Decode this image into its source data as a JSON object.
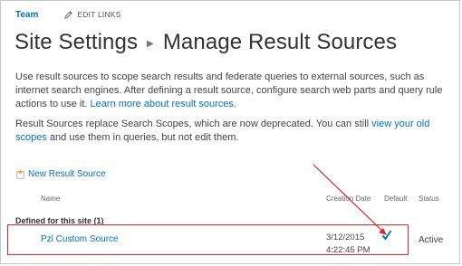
{
  "nav": {
    "site": "Team",
    "edit_links": "EDIT LINKS"
  },
  "page": {
    "breadcrumb_parent": "Site Settings",
    "title": "Manage Result Sources"
  },
  "intro": {
    "text": "Use result sources to scope search results and federate queries to external sources, such as internet search engines. After defining a result source, configure search web parts and query rule actions to use it. ",
    "link": "Learn more about result sources.",
    "end": ""
  },
  "deprecation": {
    "text": "Result Sources replace Search Scopes, which are now deprecated. You can still ",
    "link": "view your old scopes",
    "end": " and use them in queries, but not edit them."
  },
  "new_source": {
    "label": "New Result Source"
  },
  "columns": {
    "name": "Name",
    "creation_date": "Creation Date",
    "default": "Default",
    "status": "Status"
  },
  "group": {
    "label": "Defined for this site (1)"
  },
  "rows": [
    {
      "name": "Pzl Custom Source",
      "date": "3/12/2015",
      "time": "4:22:45 PM",
      "status": "Active"
    }
  ],
  "colors": {
    "link": "#0072c6",
    "annotation": "#e0262b",
    "new_icon": "#e8a93b"
  }
}
